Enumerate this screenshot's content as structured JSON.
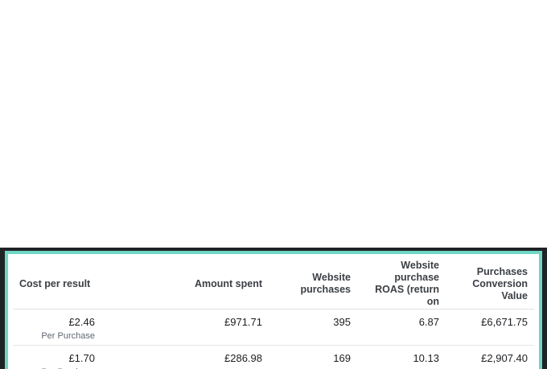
{
  "table": {
    "headers": {
      "cost_per_result": "Cost per result",
      "amount_spent": "Amount spent",
      "website_purchases": "Website purchases",
      "website_purchase_roas": "Website purchase ROAS (return on",
      "purchases_conversion_value": "Purchases Conversion Value"
    },
    "rows": [
      {
        "cost_per_result": "£2.46",
        "result_type": "Per Purchase",
        "amount_spent": "£971.71",
        "website_purchases": "395",
        "website_purchase_roas": "6.87",
        "purchases_conversion_value": "£6,671.75"
      },
      {
        "cost_per_result": "£1.70",
        "result_type": "Per Purchase",
        "amount_spent": "£286.98",
        "website_purchases": "169",
        "website_purchase_roas": "10.13",
        "purchases_conversion_value": "£2,907.40"
      }
    ]
  },
  "colors": {
    "frame_border": "#6fd6c4",
    "frame_background": "#1f2326"
  }
}
